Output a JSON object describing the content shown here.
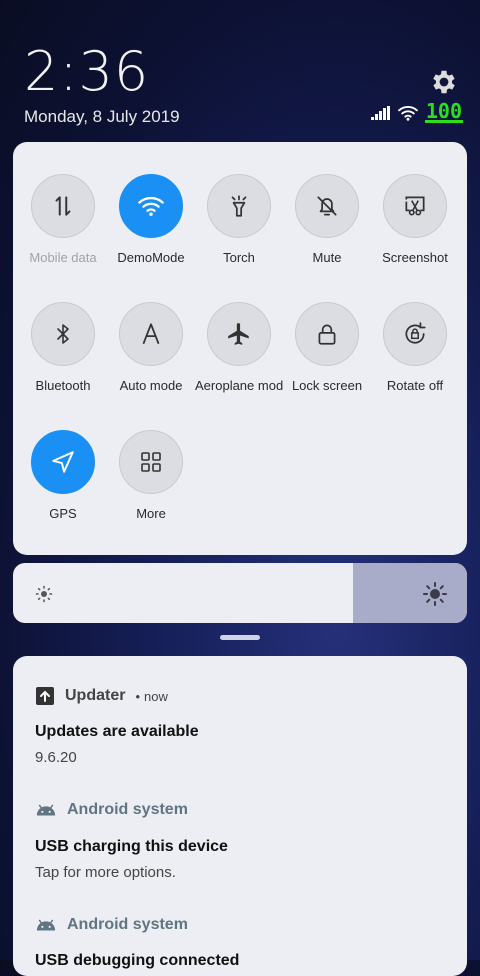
{
  "status": {
    "time": "2:36",
    "date": "Monday, 8 July 2019",
    "battery": "100"
  },
  "tiles": [
    {
      "label": "Mobile data",
      "icon": "mobile-data-icon",
      "active": false
    },
    {
      "label": "DemoMode",
      "icon": "wifi-icon",
      "active": true
    },
    {
      "label": "Torch",
      "icon": "torch-icon",
      "active": false
    },
    {
      "label": "Mute",
      "icon": "bell-off-icon",
      "active": false
    },
    {
      "label": "Screenshot",
      "icon": "screenshot-icon",
      "active": false
    },
    {
      "label": "Bluetooth",
      "icon": "bluetooth-icon",
      "active": false
    },
    {
      "label": "Auto mode",
      "icon": "auto-mode-icon",
      "active": false
    },
    {
      "label": "Aeroplane mode",
      "icon": "airplane-icon",
      "active": false
    },
    {
      "label": "Lock screen",
      "icon": "lock-icon",
      "active": false
    },
    {
      "label": "Rotate off",
      "icon": "rotate-lock-icon",
      "active": false
    },
    {
      "label": "GPS",
      "icon": "location-icon",
      "active": true
    },
    {
      "label": "More",
      "icon": "grid-icon",
      "active": false
    }
  ],
  "brightness": {
    "level_percent": 75
  },
  "notifications": [
    {
      "app": "Updater",
      "time": "now",
      "title": "Updates are available",
      "body": "9.6.20"
    },
    {
      "app": "Android system",
      "title": "USB charging this device",
      "body": "Tap for more options."
    },
    {
      "app": "Android system",
      "title": "USB debugging connected"
    }
  ],
  "colors": {
    "accent": "#1a90f5",
    "battery": "#29e01d",
    "android": "#5f7582"
  }
}
